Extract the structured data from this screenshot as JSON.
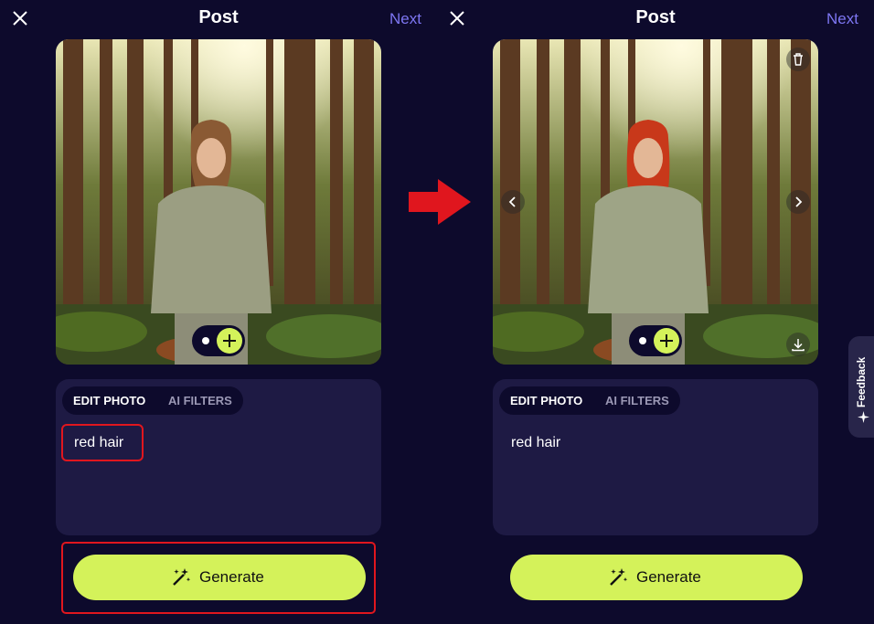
{
  "header": {
    "title": "Post",
    "next_label": "Next"
  },
  "left_panel": {
    "tabs": {
      "edit_photo": "EDIT PHOTO",
      "ai_filters": "AI FILTERS"
    },
    "prompt_text": "red hair",
    "generate_label": "Generate"
  },
  "right_panel": {
    "tabs": {
      "edit_photo": "EDIT PHOTO",
      "ai_filters": "AI FILTERS"
    },
    "prompt_text": "red hair",
    "generate_label": "Generate"
  },
  "feedback_label": "Feedback",
  "colors": {
    "background": "#0d0a2c",
    "card": "#1e1a44",
    "accent": "#d4f25a",
    "next_link": "#7d76f2",
    "highlight_red": "#e0161e"
  },
  "icons": [
    "close-icon",
    "plus-icon",
    "magic-wand-icon",
    "trash-icon",
    "chevron-left-icon",
    "chevron-right-icon",
    "download-icon",
    "sparkle-icon",
    "arrow-right-icon"
  ]
}
